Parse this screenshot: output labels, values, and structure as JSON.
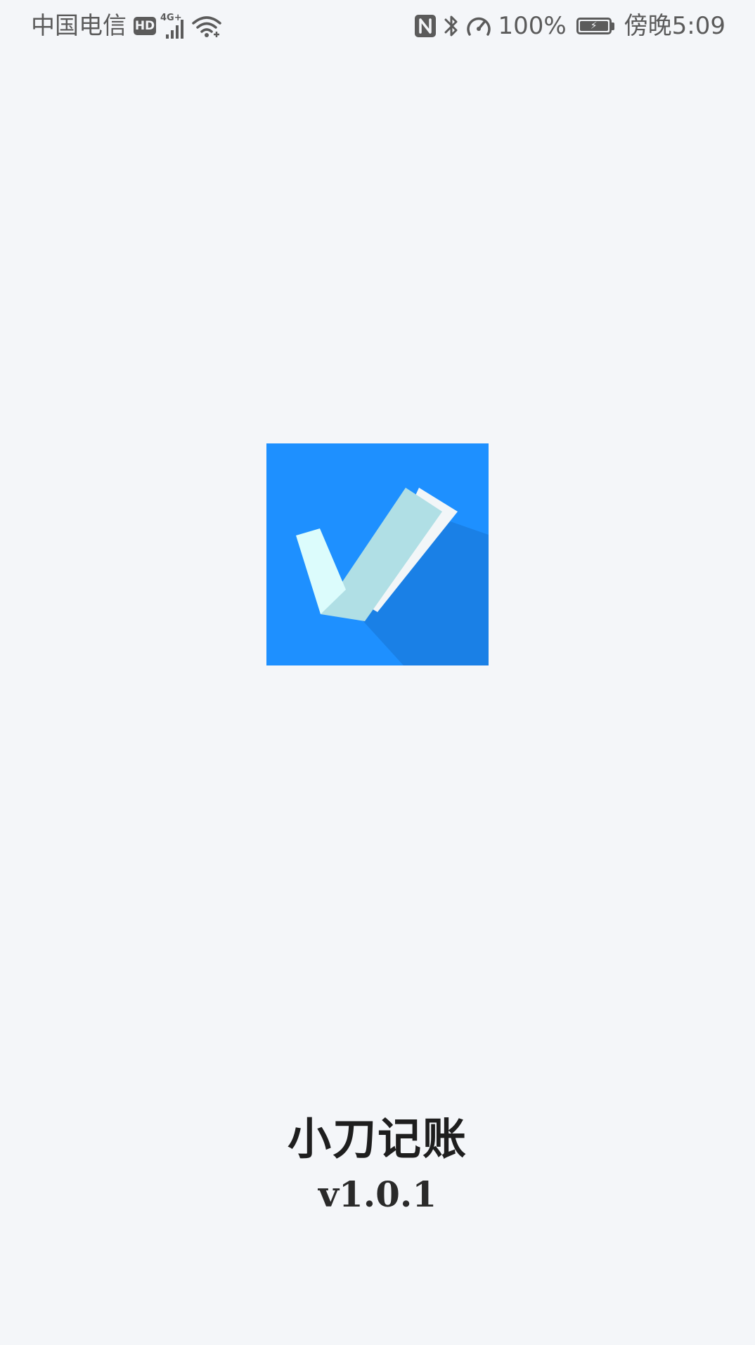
{
  "status_bar": {
    "carrier": "中国电信",
    "hd_badge": "HD",
    "network_type": "4G+",
    "battery_percent": "100%",
    "battery_level": 1.0,
    "time": "傍晚5:09",
    "icons": [
      "hd-icon",
      "signal-icon",
      "wifi-icon",
      "nfc-icon",
      "bluetooth-icon",
      "speedometer-icon",
      "battery-charging-icon"
    ]
  },
  "splash": {
    "app_name": "小刀记账",
    "version": "v1.0.1",
    "logo_icon": "checkmark-logo-icon",
    "logo_colors": {
      "background": "#1e90ff",
      "shadow": "#1a80e6",
      "check_left": "#dcfcfc",
      "check_right": "#b0dfe5",
      "paper_edge": "#f2f6f8"
    }
  }
}
